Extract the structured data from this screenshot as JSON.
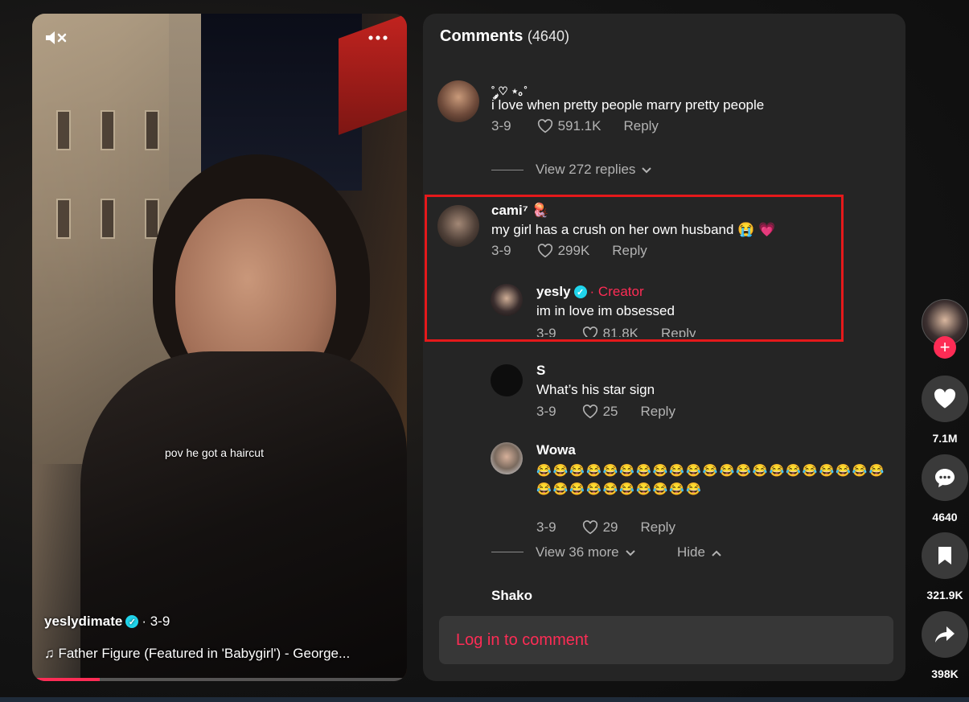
{
  "video": {
    "caption_overlay": "pov he got a haircut",
    "author": "yeslydimate",
    "date": "· 3-9",
    "music": "♫  Father Figure (Featured in 'Babygirl') - George...",
    "progress_percent": 18,
    "mute_icon": "muted-speaker-icon",
    "more_icon": "more-dots-icon"
  },
  "comments": {
    "title": "Comments",
    "count": "(4640)",
    "items": [
      {
        "user": "˚ ༘♡ ⋆｡˚",
        "text": "i love when pretty people marry pretty people",
        "date": "3-9",
        "likes": "591.1K",
        "reply_label": "Reply",
        "view_replies": "View 272 replies"
      },
      {
        "user": "cami⁷ 🪼",
        "text": "my girl has a crush on her own husband 😭 💗",
        "date": "3-9",
        "likes": "299K",
        "reply_label": "Reply"
      }
    ],
    "replies": [
      {
        "user": "yesly",
        "creator_tag": "· Creator",
        "text": "im in love im obsessed",
        "date": "3-9",
        "likes": "81.8K",
        "reply_label": "Reply"
      },
      {
        "user": "S",
        "text": "What’s his star sign",
        "date": "3-9",
        "likes": "25",
        "reply_label": "Reply"
      },
      {
        "user": "Wowa",
        "text": "😂😂😂😂😂😂😂😂😂😂😂😂😂😂😂😂😂😂😂😂😂😂😂😂😂😂😂😂😂😂😂",
        "date": "3-9",
        "likes": "29",
        "reply_label": "Reply"
      }
    ],
    "view_more": "View 36 more",
    "hide": "Hide",
    "next_user": "Shako",
    "login_prompt": "Log in to comment"
  },
  "rail": {
    "likes": "7.1M",
    "comments": "4640",
    "saves": "321.9K",
    "shares": "398K"
  },
  "colors": {
    "accent": "#fe2c55",
    "verified": "#20d5ec",
    "highlight": "#e5191b",
    "panel": "#252525"
  }
}
